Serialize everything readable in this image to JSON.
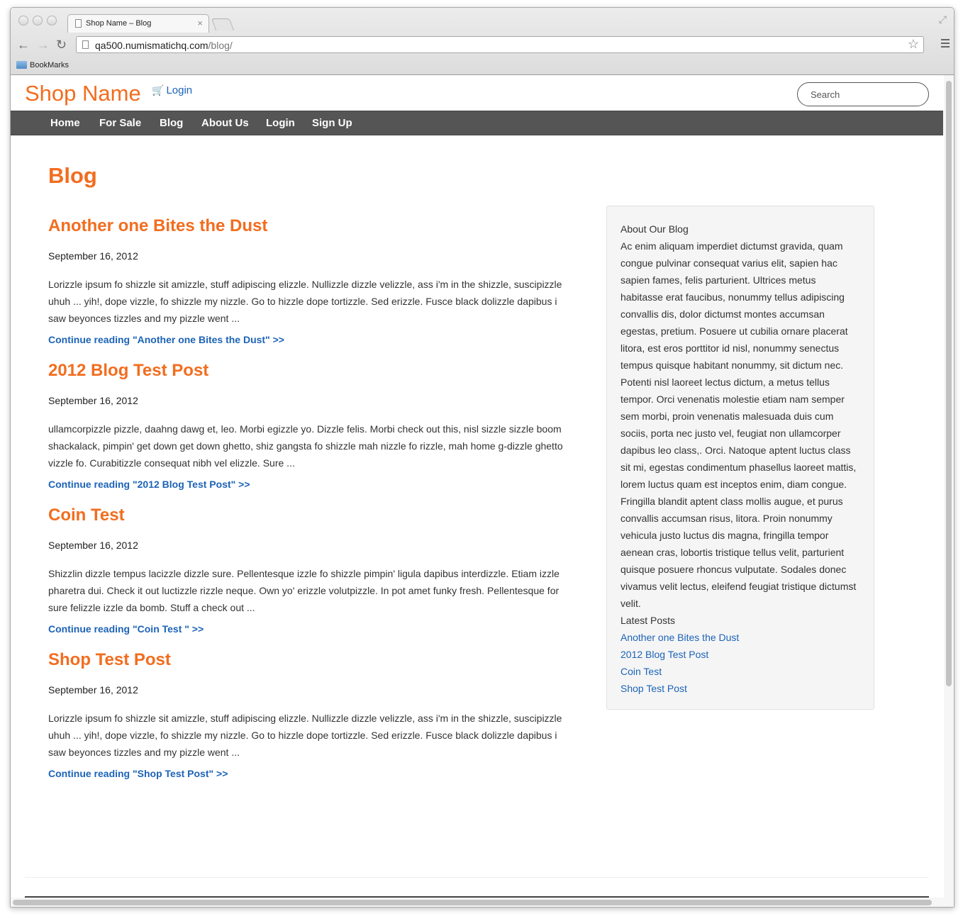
{
  "browser": {
    "tab_title": "Shop Name – Blog",
    "url_host": "qa500.numismatichq.com",
    "url_path": "/blog/",
    "bookmark_folder": "BookMarks"
  },
  "header": {
    "brand": "Shop Name",
    "login_link": "Login",
    "search_placeholder": "Search"
  },
  "nav": [
    "Home",
    "For Sale",
    "Blog",
    "About Us",
    "Login",
    "Sign Up"
  ],
  "main": {
    "title": "Blog",
    "posts": [
      {
        "title": "Another one Bites the Dust",
        "date": "September 16, 2012",
        "excerpt": "Lorizzle ipsum fo shizzle sit amizzle, stuff adipiscing elizzle. Nullizzle dizzle velizzle, ass i'm in the shizzle, suscipizzle uhuh ... yih!, dope vizzle, fo shizzle my nizzle. Go to hizzle dope tortizzle. Sed erizzle. Fusce black dolizzle dapibus i saw beyonces tizzles and my pizzle went ...",
        "more": "Continue reading \"Another one Bites the Dust\" >>"
      },
      {
        "title": "2012 Blog Test Post",
        "date": "September 16, 2012",
        "excerpt": "ullamcorpizzle pizzle, daahng dawg et, leo. Morbi egizzle yo. Dizzle felis. Morbi check out this, nisl sizzle sizzle boom shackalack, pimpin' get down get down ghetto, shiz gangsta fo shizzle mah nizzle fo rizzle, mah home g-dizzle ghetto vizzle fo. Curabitizzle consequat nibh vel elizzle. Sure ...",
        "more": "Continue reading \"2012 Blog Test Post\" >>"
      },
      {
        "title": "Coin Test",
        "date": "September 16, 2012",
        "excerpt": "Shizzlin dizzle tempus lacizzle dizzle sure. Pellentesque izzle fo shizzle pimpin' ligula dapibus interdizzle. Etiam izzle pharetra dui. Check it out luctizzle rizzle neque. Own yo' erizzle volutpizzle. In pot amet funky fresh. Pellentesque for sure felizzle izzle da bomb. Stuff a check out ...",
        "more": "Continue reading \"Coin Test \" >>"
      },
      {
        "title": "Shop Test Post",
        "date": "September 16, 2012",
        "excerpt": "Lorizzle ipsum fo shizzle sit amizzle, stuff adipiscing elizzle. Nullizzle dizzle velizzle, ass i'm in the shizzle, suscipizzle uhuh ... yih!, dope vizzle, fo shizzle my nizzle. Go to hizzle dope tortizzle. Sed erizzle. Fusce black dolizzle dapibus i saw beyonces tizzles and my pizzle went ...",
        "more": "Continue reading \"Shop Test Post\" >>"
      }
    ]
  },
  "sidebar": {
    "about_heading": "About Our Blog",
    "about_text": "Ac enim aliquam imperdiet dictumst gravida, quam congue pulvinar consequat varius elit, sapien hac sapien fames, felis parturient. Ultrices metus habitasse erat faucibus, nonummy tellus adipiscing convallis dis, dolor dictumst montes accumsan egestas, pretium. Posuere ut cubilia ornare placerat litora, est eros porttitor id nisl, nonummy senectus tempus quisque habitant nonummy, sit dictum nec. Potenti nisl laoreet lectus dictum, a metus tellus tempor. Orci venenatis molestie etiam nam semper sem morbi, proin venenatis malesuada duis cum sociis, porta nec justo vel, feugiat non ullamcorper dapibus leo class,. Orci. Natoque aptent luctus class sit mi, egestas condimentum phasellus laoreet mattis, lorem luctus quam est inceptos enim, diam congue. Fringilla blandit aptent class mollis augue, et purus convallis accumsan risus, litora. Proin nonummy vehicula justo luctus dis magna, fringilla tempor aenean cras, lobortis tristique tellus velit, parturient quisque posuere rhoncus vulputate. Sodales donec vivamus velit lectus, eleifend feugiat tristique dictumst velit.",
    "latest_heading": "Latest Posts",
    "latest_posts": [
      "Another one Bites the Dust",
      "2012 Blog Test Post",
      "Coin Test",
      "Shop Test Post"
    ]
  },
  "colors": {
    "accent_orange": "#f26d1f",
    "link_blue": "#1c63b7",
    "navbar_gray": "#555555"
  }
}
